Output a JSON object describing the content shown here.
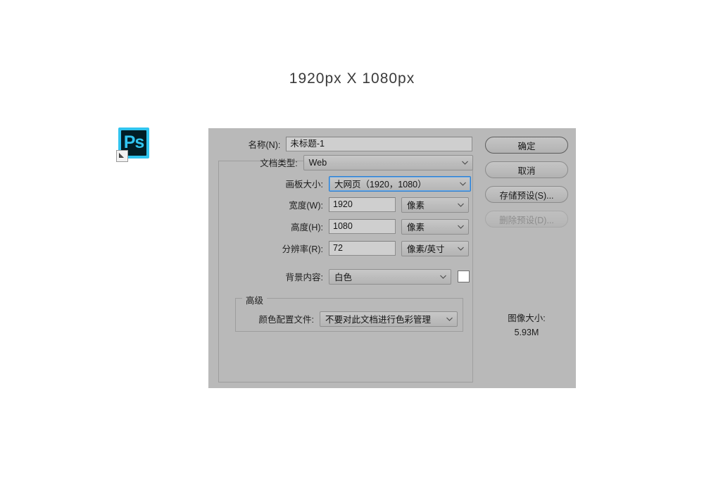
{
  "page": {
    "caption": "1920px  X  1080px",
    "background_color": "#ffffff"
  },
  "desktop_icon": {
    "name": "Ps",
    "label": "Ps",
    "border_color": "#31c5f0",
    "fill_color": "#011e26",
    "text_color": "#31c5f0"
  },
  "dialog": {
    "background_color": "#b9b9b9",
    "fields": {
      "name": {
        "label": "名称(N):",
        "value": "未标题-1",
        "placeholder": "未标题-1"
      },
      "doc_type": {
        "label": "文档类型:",
        "value": "Web"
      },
      "artboard_size": {
        "label": "画板大小:",
        "value": "大网页（1920，1080）",
        "focus_color": "#2a7fd4"
      },
      "width": {
        "label": "宽度(W):",
        "value": "1920",
        "unit": "像素"
      },
      "height": {
        "label": "高度(H):",
        "value": "1080",
        "unit": "像素"
      },
      "resolution": {
        "label": "分辨率(R):",
        "value": "72",
        "unit": "像素/英寸"
      },
      "background_contents": {
        "label": "背景内容:",
        "value": "白色",
        "swatch_color": "#ffffff"
      },
      "advanced": {
        "legend": "高级",
        "color_profile": {
          "label": "颜色配置文件:",
          "value": "不要对此文档进行色彩管理"
        }
      }
    },
    "buttons": {
      "ok": "确定",
      "cancel": "取消",
      "save_preset": "存储预设(S)...",
      "delete_preset": "删除预设(D)..."
    },
    "image_size": {
      "label": "图像大小:",
      "value": "5.93M"
    }
  }
}
